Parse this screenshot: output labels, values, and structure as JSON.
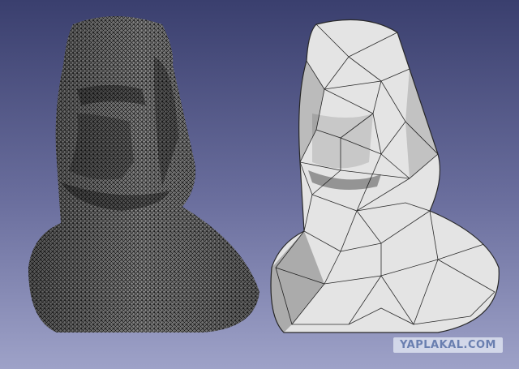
{
  "viewport": {
    "background_top": "#3a3f6e",
    "background_bottom": "#9ea2c8"
  },
  "models": [
    {
      "name": "moai-fine-mesh",
      "mesh_density": "fine",
      "fill": "#8c8c8c",
      "wire": "#101010"
    },
    {
      "name": "moai-coarse-mesh",
      "mesh_density": "coarse",
      "fill": "#e4e4e4",
      "wire": "#2a2a2a"
    }
  ],
  "watermark": {
    "text": "YAPLAKAL.COM"
  }
}
